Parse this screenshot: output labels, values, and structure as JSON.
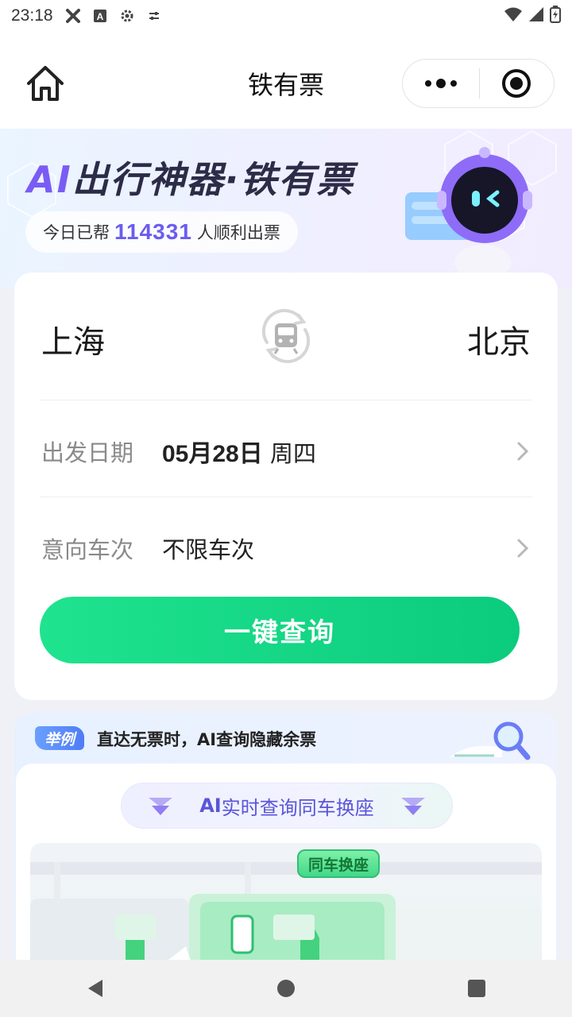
{
  "status_bar": {
    "time": "23:18",
    "icons": [
      "tools-icon",
      "a-icon",
      "gear-icon",
      "sliders-icon"
    ],
    "right_icons": [
      "wifi-icon",
      "signal-icon",
      "battery-charging-icon"
    ]
  },
  "title_bar": {
    "title": "铁有票",
    "home_icon": "home-icon",
    "more_icon": "more-dots-icon",
    "close_icon": "target-circle-icon"
  },
  "banner": {
    "title_ai": "AI",
    "title_rest": "出行神器·铁有票",
    "pill_prefix": "今日已帮",
    "pill_count": "114331",
    "pill_suffix": "人顺利出票",
    "mascot_icon": "robot-icon"
  },
  "search": {
    "from_city": "上海",
    "to_city": "北京",
    "swap_icon": "train-swap-icon",
    "date_label": "出发日期",
    "date_value": "05月28日",
    "weekday": "周四",
    "train_label": "意向车次",
    "train_value": "不限车次",
    "query_button": "一键查询"
  },
  "example": {
    "badge": "举例",
    "text": "直达无票时，AI查询隐藏余票",
    "subtitle_ai": "AI",
    "subtitle_rest": "实时查询同车换座",
    "seat_tag": "同车换座",
    "deco_icon": "magnifier-train-icon"
  },
  "colors": {
    "accent_green": "#0bcb7d",
    "accent_purple": "#6b5cf0",
    "badge_blue": "#4f7cf5"
  },
  "nav": {
    "back_icon": "back-triangle-icon",
    "home_icon": "home-circle-icon",
    "recents_icon": "recents-square-icon"
  }
}
